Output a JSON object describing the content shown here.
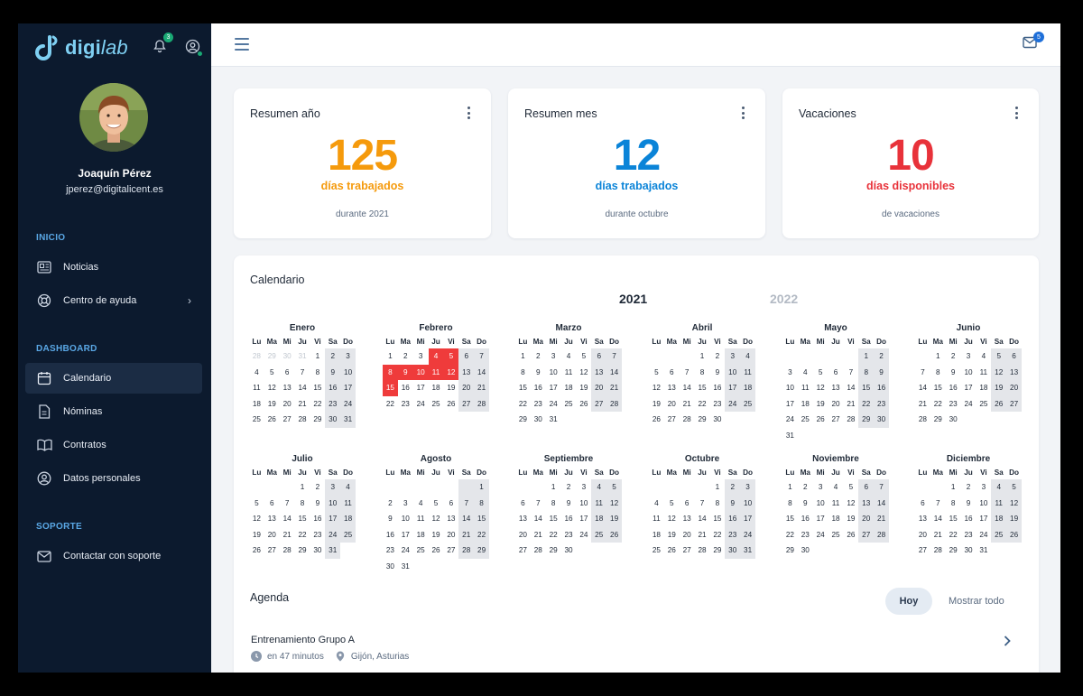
{
  "brand": {
    "name_bold": "digi",
    "name_italic": "lab"
  },
  "notifications": {
    "count": "3"
  },
  "user": {
    "name": "Joaquín Pérez",
    "email": "jperez@digitalicent.es"
  },
  "sidebar": {
    "sections": [
      {
        "label": "INICIO"
      },
      {
        "label": "DASHBOARD"
      },
      {
        "label": "SOPORTE"
      }
    ],
    "items": [
      {
        "label": "Noticias",
        "icon": "news-icon"
      },
      {
        "label": "Centro de ayuda",
        "icon": "lifebuoy-icon"
      },
      {
        "label": "Calendario",
        "icon": "calendar-icon",
        "active": true
      },
      {
        "label": "Nóminas",
        "icon": "document-icon"
      },
      {
        "label": "Contratos",
        "icon": "book-icon"
      },
      {
        "label": "Datos personales",
        "icon": "user-circle-icon"
      },
      {
        "label": "Contactar con soporte",
        "icon": "mail-icon"
      }
    ]
  },
  "topbar": {
    "mail_count": "5"
  },
  "stats": [
    {
      "title": "Resumen año",
      "value": "125",
      "unit": "días trabajados",
      "note": "durante 2021",
      "color": "#f59a0c"
    },
    {
      "title": "Resumen mes",
      "value": "12",
      "unit": "días trabajados",
      "note": "durante octubre",
      "color": "#0b84d8"
    },
    {
      "title": "Vacaciones",
      "value": "10",
      "unit": "días disponibles",
      "note": "de vacaciones",
      "color": "#e8323a"
    }
  ],
  "calendar": {
    "title": "Calendario",
    "years": [
      "2021",
      "2022"
    ],
    "selected_year": "2021",
    "weekdays": [
      "Lu",
      "Ma",
      "Mi",
      "Ju",
      "Vi",
      "Sa",
      "Do"
    ],
    "months": [
      {
        "name": "Enero",
        "start": 4,
        "days": 31,
        "prev_tail": [
          28,
          29,
          30,
          31
        ],
        "highlight": []
      },
      {
        "name": "Febrero",
        "start": 0,
        "days": 28,
        "highlight": [
          4,
          5,
          8,
          9,
          10,
          11,
          12,
          15
        ]
      },
      {
        "name": "Marzo",
        "start": 0,
        "days": 31,
        "highlight": []
      },
      {
        "name": "Abril",
        "start": 3,
        "days": 30,
        "highlight": []
      },
      {
        "name": "Mayo",
        "start": 5,
        "days": 31,
        "highlight": []
      },
      {
        "name": "Junio",
        "start": 1,
        "days": 30,
        "highlight": []
      },
      {
        "name": "Julio",
        "start": 3,
        "days": 31,
        "highlight": []
      },
      {
        "name": "Agosto",
        "start": 6,
        "days": 31,
        "highlight": []
      },
      {
        "name": "Septiembre",
        "start": 2,
        "days": 30,
        "highlight": []
      },
      {
        "name": "Octubre",
        "start": 4,
        "days": 31,
        "highlight": []
      },
      {
        "name": "Noviembre",
        "start": 0,
        "days": 30,
        "highlight": []
      },
      {
        "name": "Diciembre",
        "start": 2,
        "days": 31,
        "highlight": []
      }
    ]
  },
  "agenda": {
    "title": "Agenda",
    "filters": [
      "Hoy",
      "Mostrar todo"
    ],
    "events": [
      {
        "title": "Entrenamiento Grupo A",
        "time": "en 47 minutos",
        "place": "Gijón, Asturias"
      }
    ]
  }
}
